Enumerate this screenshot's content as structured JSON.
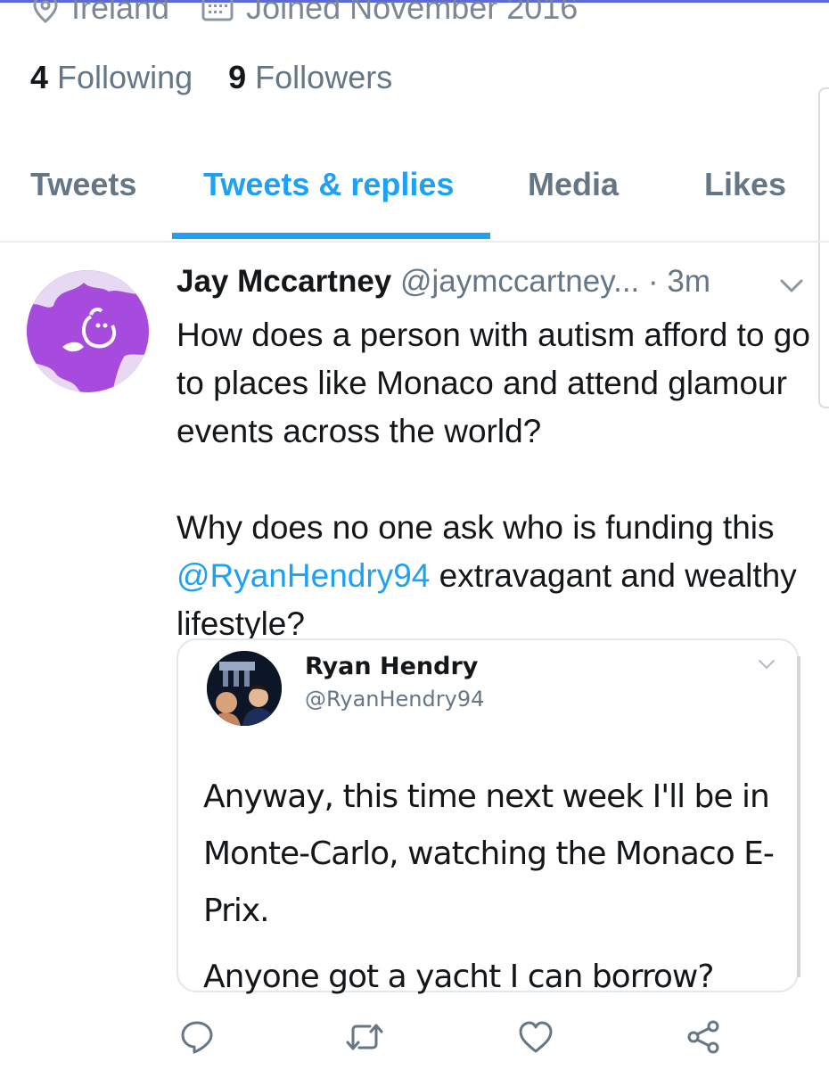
{
  "profile": {
    "location": "Ireland",
    "joined": "Joined November 2016",
    "following_count": "4",
    "following_label": "Following",
    "followers_count": "9",
    "followers_label": "Followers"
  },
  "tabs": [
    {
      "label": "Tweets",
      "active": false
    },
    {
      "label": "Tweets & replies",
      "active": true
    },
    {
      "label": "Media",
      "active": false
    },
    {
      "label": "Likes",
      "active": false
    }
  ],
  "tweet": {
    "author_name": "Jay Mccartney",
    "author_handle": "@jaymccartney...",
    "time": "· 3m",
    "para1": "How does a person with autism afford to go to places like Monaco and attend glamour events across the world?",
    "para2_before": "Why does no one ask who is funding this ",
    "mention": "@RyanHendry94",
    "para2_after": " extravagant and wealthy lifestyle?"
  },
  "quoted": {
    "author_name": "Ryan Hendry",
    "author_handle": "@RyanHendry94",
    "para1": "Anyway, this time next week I'll be in Monte-Carlo, watching the Monaco E-Prix.",
    "para2": "Anyone got a yacht I can borrow?"
  },
  "actions": {
    "reply_icon": "reply-icon",
    "retweet_icon": "retweet-icon",
    "like_icon": "heart-icon",
    "share_icon": "share-icon"
  },
  "colors": {
    "accent": "#1da1f2",
    "secondary_text": "#657786",
    "avatar_purple": "#a64bdd"
  }
}
